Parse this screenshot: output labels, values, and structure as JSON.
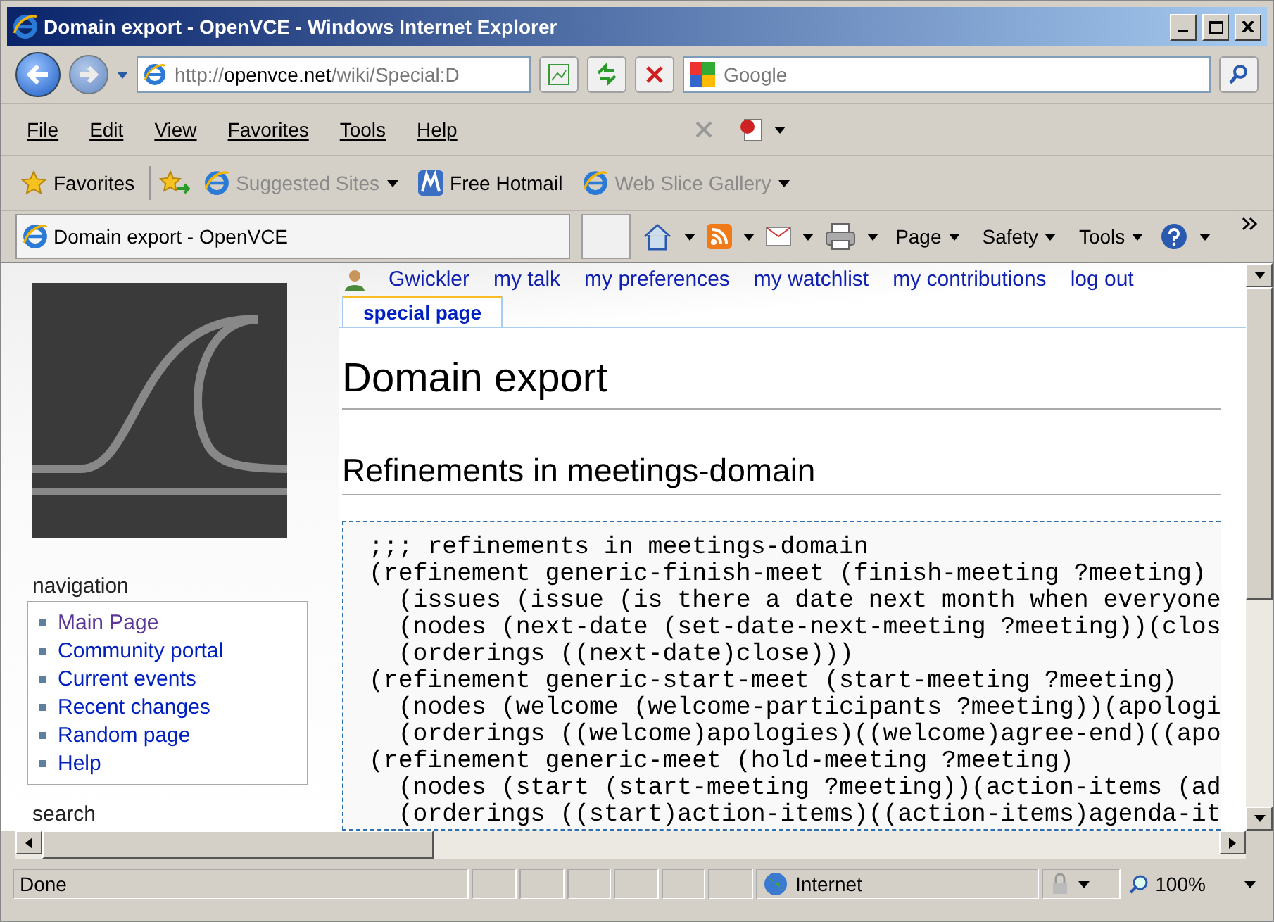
{
  "window": {
    "title": "Domain export - OpenVCE - Windows Internet Explorer"
  },
  "address": {
    "prefix": "http://",
    "host": "openvce.net",
    "path": "/wiki/Special:D"
  },
  "search": {
    "placeholder": "Google"
  },
  "menu": [
    "File",
    "Edit",
    "View",
    "Favorites",
    "Tools",
    "Help"
  ],
  "favorites": {
    "label": "Favorites",
    "links": [
      {
        "label": "Suggested Sites",
        "dim": true,
        "dropdown": true
      },
      {
        "label": "Free Hotmail",
        "dim": false,
        "dropdown": false
      },
      {
        "label": "Web Slice Gallery",
        "dim": true,
        "dropdown": true
      }
    ]
  },
  "tab": {
    "title": "Domain export - OpenVCE"
  },
  "command_bar": [
    "Page",
    "Safety",
    "Tools"
  ],
  "user_links": [
    "Gwickler",
    "my talk",
    "my preferences",
    "my watchlist",
    "my contributions",
    "log out"
  ],
  "page_tabs": [
    {
      "label": "special page",
      "selected": true
    }
  ],
  "page": {
    "title": "Domain export",
    "heading": "Refinements in meetings-domain",
    "code": [
      ";;; refinements in meetings-domain",
      "(refinement generic-finish-meet (finish-meeting ?meeting)",
      "  (issues (issue (is there a date next month when everyone",
      "  (nodes (next-date (set-date-next-meeting ?meeting))(clos",
      "  (orderings ((next-date)close)))",
      "(refinement generic-start-meet (start-meeting ?meeting)",
      "  (nodes (welcome (welcome-participants ?meeting))(apologi",
      "  (orderings ((welcome)apologies)((welcome)agree-end)((apo",
      "(refinement generic-meet (hold-meeting ?meeting)",
      "  (nodes (start (start-meeting ?meeting))(action-items (ad",
      "  (orderings ((start)action-items)((action-items)agenda-it"
    ]
  },
  "navigation": {
    "title": "navigation",
    "items": [
      {
        "label": "Main Page",
        "visited": true
      },
      {
        "label": "Community portal",
        "visited": false
      },
      {
        "label": "Current events",
        "visited": false
      },
      {
        "label": "Recent changes",
        "visited": false
      },
      {
        "label": "Random page",
        "visited": false
      },
      {
        "label": "Help",
        "visited": false
      }
    ]
  },
  "sidebar_next": "search",
  "status_bar": {
    "text": "Done",
    "zone": "Internet",
    "zoom": "100%"
  }
}
